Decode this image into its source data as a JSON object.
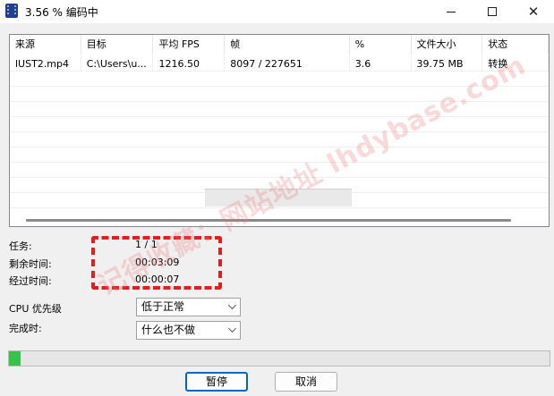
{
  "window": {
    "title": "3.56 % 编码中",
    "minimize_icon": "minimize-icon",
    "maximize_icon": "maximize-icon",
    "close_icon": "close-icon",
    "close_glyph": "✕"
  },
  "table": {
    "headers": [
      "来源",
      "目标",
      "平均 FPS",
      "帧",
      "%",
      "文件大小",
      "状态"
    ],
    "rows": [
      [
        "lUST2.mp4",
        "C:\\Users\\u...",
        "1216.50",
        "8097 / 227651",
        "3.6",
        "39.75 MB",
        "转换"
      ]
    ]
  },
  "info": {
    "task_label": "任务:",
    "task_value": "1 / 1",
    "remaining_label": "剩余时间:",
    "remaining_value": "00:03:09",
    "elapsed_label": "经过时间:",
    "elapsed_value": "00:00:07"
  },
  "options": {
    "cpu_priority_label": "CPU 优先级",
    "cpu_priority_value": "低于正常",
    "on_complete_label": "完成时:",
    "on_complete_value": "什么也不做"
  },
  "progress": {
    "percent": 2.2,
    "color": "#37c24a"
  },
  "buttons": {
    "pause_label": "暂停",
    "cancel_label": "取消"
  },
  "watermark": {
    "text": "记得收藏：网站地址 lhdybase.com"
  },
  "colors": {
    "accent": "#0067c0",
    "highlight_box": "#e02020"
  }
}
